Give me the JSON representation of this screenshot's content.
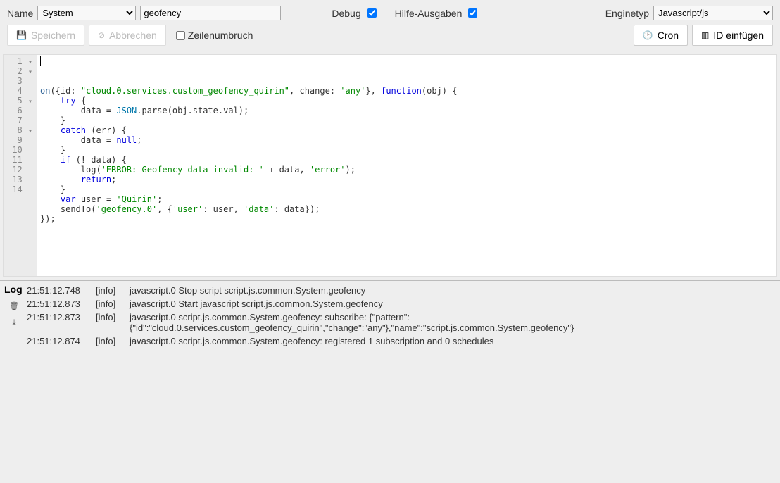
{
  "header": {
    "name_label": "Name",
    "group_value": "System",
    "script_name": "geofency",
    "debug_label": "Debug",
    "debug_checked": true,
    "hilfe_label": "Hilfe-Ausgaben",
    "hilfe_checked": true,
    "enginetyp_label": "Enginetyp",
    "engine_value": "Javascript/js"
  },
  "toolbar": {
    "save_label": "Speichern",
    "cancel_label": "Abbrechen",
    "wrap_label": "Zeilenumbruch",
    "wrap_checked": false,
    "cron_label": "Cron",
    "insertid_label": "ID einfügen"
  },
  "code": {
    "lines": [
      {
        "n": 1,
        "fold": "▾",
        "html": "<span class='fn'>on</span>({id: <span class='str'>\"cloud.0.services.custom_geofency_quirin\"</span>, change: <span class='str'>'any'</span>}, <span class='kw'>function</span>(obj) {"
      },
      {
        "n": 2,
        "fold": "▾",
        "html": "    <span class='kw'>try</span> {"
      },
      {
        "n": 3,
        "fold": "",
        "html": "        data = <span class='id2'>JSON</span>.parse(obj.state.val);"
      },
      {
        "n": 4,
        "fold": "",
        "html": "    }"
      },
      {
        "n": 5,
        "fold": "▾",
        "html": "    <span class='kw'>catch</span> (err) {"
      },
      {
        "n": 6,
        "fold": "",
        "html": "        data = <span class='kw'>null</span>;"
      },
      {
        "n": 7,
        "fold": "",
        "html": "    }"
      },
      {
        "n": 8,
        "fold": "▾",
        "html": "    <span class='kw'>if</span> (! data) {"
      },
      {
        "n": 9,
        "fold": "",
        "html": "        log(<span class='str'>'ERROR: Geofency data invalid: '</span> + data, <span class='str'>'error'</span>);"
      },
      {
        "n": 10,
        "fold": "",
        "html": "        <span class='kw'>return</span>;"
      },
      {
        "n": 11,
        "fold": "",
        "html": "    }"
      },
      {
        "n": 12,
        "fold": "",
        "html": "    <span class='kw'>var</span> user = <span class='str'>'Quirin'</span>;"
      },
      {
        "n": 13,
        "fold": "",
        "html": "    sendTo(<span class='str'>'geofency.0'</span>, {<span class='str'>'user'</span>: user, <span class='str'>'data'</span>: data});"
      },
      {
        "n": 14,
        "fold": "",
        "html": "});"
      }
    ]
  },
  "log": {
    "title": "Log",
    "rows": [
      {
        "time": "21:51:12.748",
        "level": "[info]",
        "msg": "javascript.0 Stop script script.js.common.System.geofency"
      },
      {
        "time": "21:51:12.873",
        "level": "[info]",
        "msg": "javascript.0 Start javascript script.js.common.System.geofency"
      },
      {
        "time": "21:51:12.873",
        "level": "[info]",
        "msg": "javascript.0 script.js.common.System.geofency: subscribe: {\"pattern\":{\"id\":\"cloud.0.services.custom_geofency_quirin\",\"change\":\"any\"},\"name\":\"script.js.common.System.geofency\"}"
      },
      {
        "time": "21:51:12.874",
        "level": "[info]",
        "msg": "javascript.0 script.js.common.System.geofency: registered 1 subscription and 0 schedules"
      }
    ]
  }
}
